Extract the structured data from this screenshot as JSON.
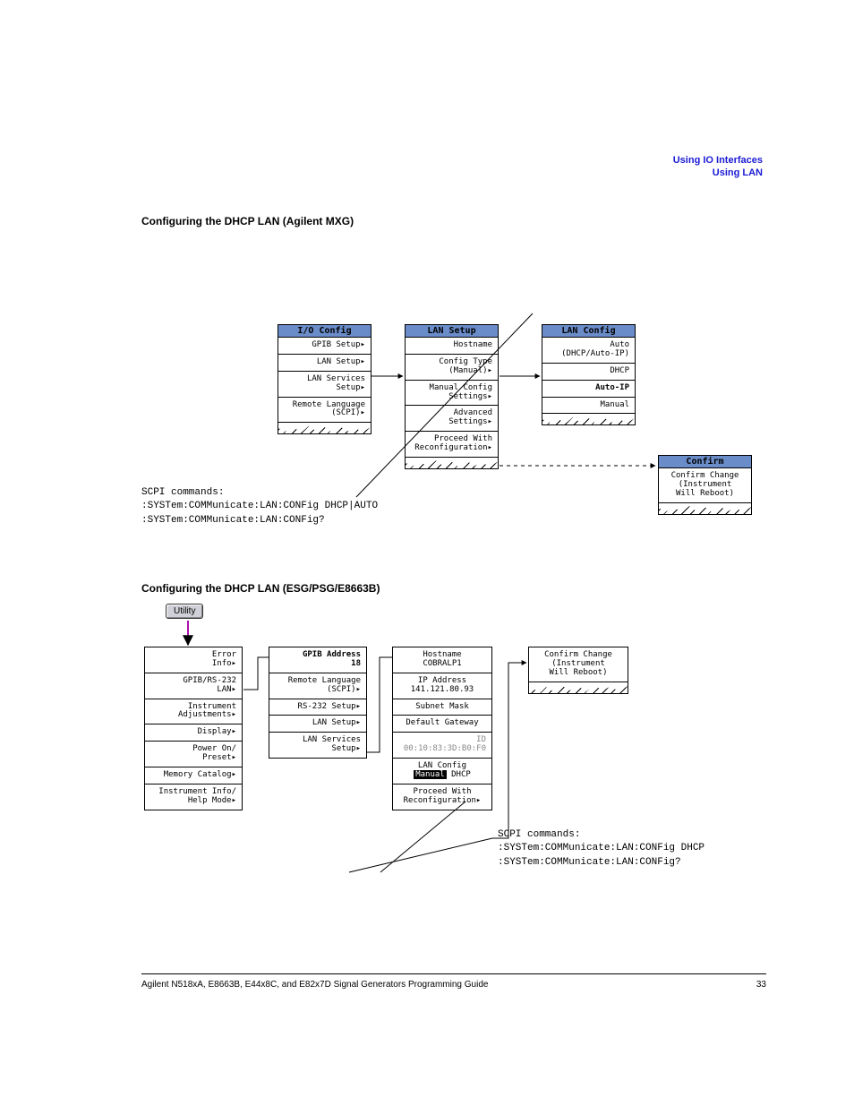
{
  "header": {
    "line1": "Using IO Interfaces",
    "line2": "Using LAN"
  },
  "section1": {
    "title": "Configuring the DHCP LAN (Agilent MXG)",
    "menu1": {
      "header": "I/O Config",
      "items": [
        "GPIB Setup▸",
        "LAN Setup▸",
        "LAN Services\nSetup▸",
        "Remote Language\n(SCPI)▸"
      ]
    },
    "menu2": {
      "header": "LAN Setup",
      "items": [
        "Hostname",
        "Config Type\n(Manual)▸",
        "Manual Config\nSettings▸",
        "Advanced\nSettings▸",
        "Proceed With\nReconfiguration▸"
      ]
    },
    "menu3": {
      "header": "LAN Config",
      "items": [
        "Auto\n(DHCP/Auto-IP)",
        "DHCP",
        "Auto-IP",
        "Manual"
      ]
    },
    "menu4": {
      "header": "Confirm",
      "items": [
        "Confirm Change\n(Instrument\nWill Reboot)"
      ]
    },
    "code": [
      "SCPI commands:",
      ":SYSTem:COMMunicate:LAN:CONFig DHCP|AUTO",
      ":SYSTem:COMMunicate:LAN:CONFig?"
    ]
  },
  "section2": {
    "title": "Configuring the DHCP LAN (ESG/PSG/E8663B)",
    "utility": "Utility",
    "menu1": {
      "items": [
        "Error\nInfo▸",
        "GPIB/RS-232\nLAN▸",
        "Instrument\nAdjustments▸",
        "Display▸",
        "Power On/\nPreset▸",
        "Memory Catalog▸",
        "Instrument Info/\nHelp Mode▸"
      ]
    },
    "menu2": {
      "items": [
        "GPIB Address\n18",
        "Remote Language\n(SCPI)▸",
        "RS-232 Setup▸",
        "LAN Setup▸",
        "LAN Services\nSetup▸"
      ]
    },
    "menu3": {
      "items": [
        "Hostname\nCOBRALP1",
        "IP Address\n141.121.80.93",
        "Subnet Mask",
        "Default Gateway",
        "ID\n00:10:83:3D:B0:F0",
        "LAN Config\nManual DHCP",
        "Proceed With\nReconfiguration▸"
      ]
    },
    "menu4": {
      "items": [
        "Confirm Change\n(Instrument\nWill Reboot)"
      ]
    },
    "code": [
      "SCPI commands:",
      ":SYSTem:COMMunicate:LAN:CONFig DHCP",
      ":SYSTem:COMMunicate:LAN:CONFig?"
    ]
  },
  "footer": {
    "left": "Agilent N518xA, E8663B, E44x8C, and E82x7D Signal Generators Programming Guide",
    "right": "33"
  }
}
